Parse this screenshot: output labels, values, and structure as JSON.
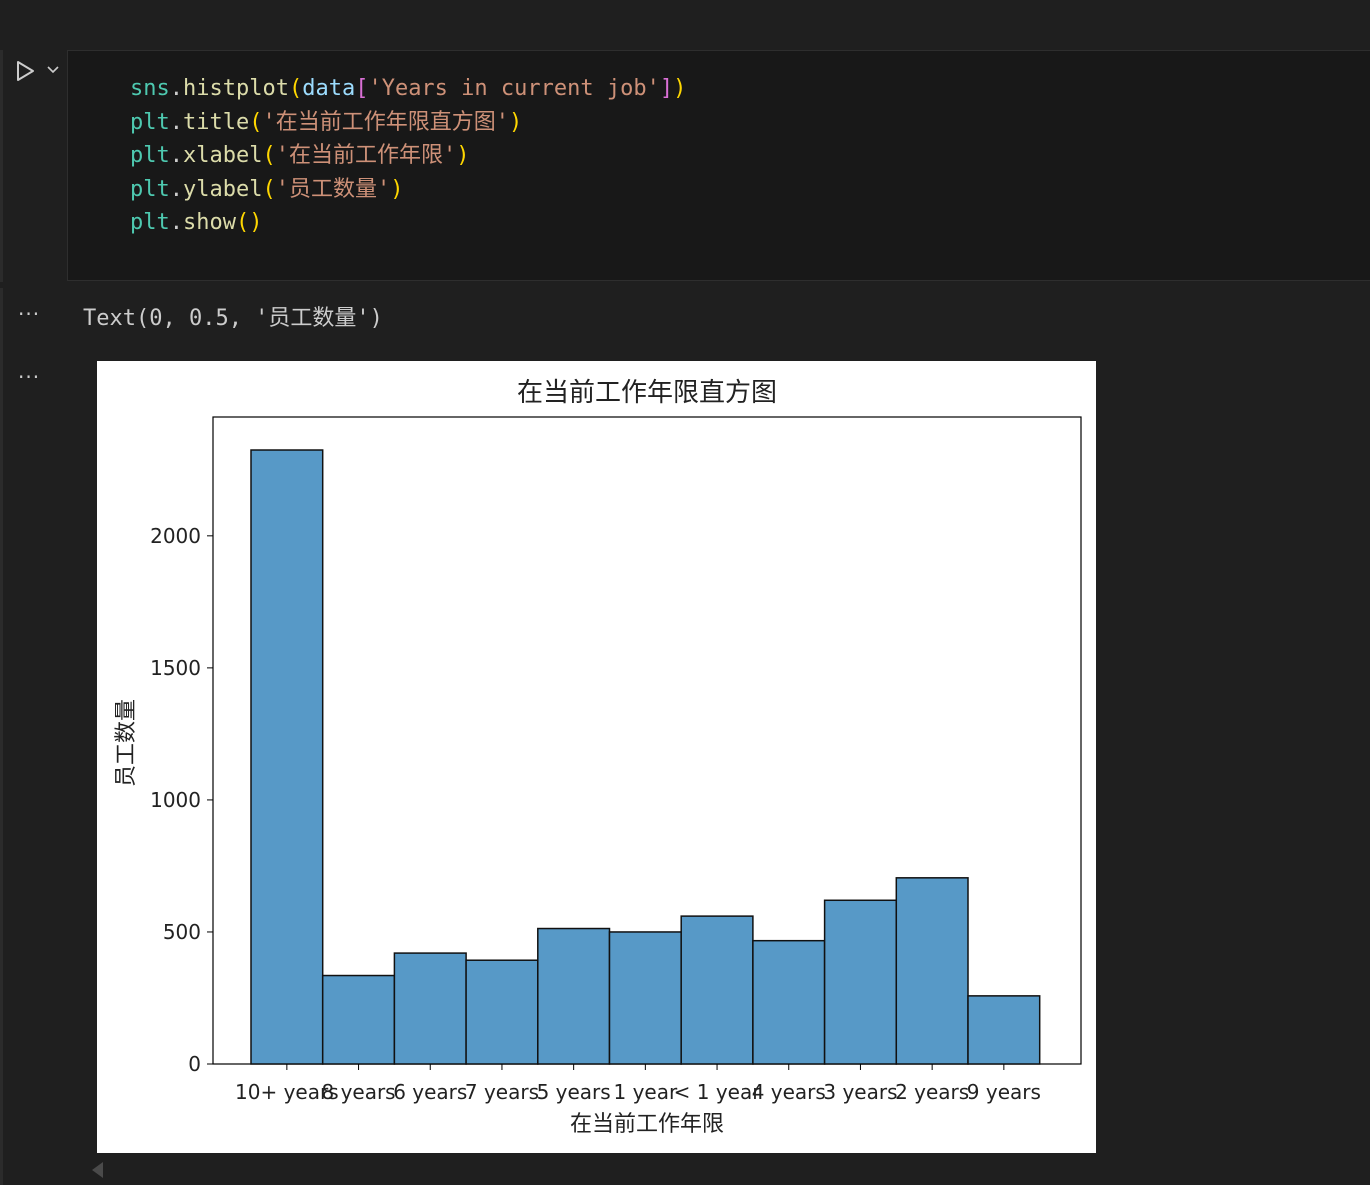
{
  "code_cell": {
    "lines": [
      [
        {
          "t": "sns",
          "c": "cyan"
        },
        {
          "t": ".",
          "c": ""
        },
        {
          "t": "histplot",
          "c": "yellow"
        },
        {
          "t": "(",
          "c": "b1"
        },
        {
          "t": "data",
          "c": "lblue"
        },
        {
          "t": "[",
          "c": "b2"
        },
        {
          "t": "'Years in current job'",
          "c": "str"
        },
        {
          "t": "]",
          "c": "b2"
        },
        {
          "t": ")",
          "c": "b1"
        }
      ],
      [
        {
          "t": "plt",
          "c": "cyan"
        },
        {
          "t": ".",
          "c": ""
        },
        {
          "t": "title",
          "c": "yellow"
        },
        {
          "t": "(",
          "c": "b1"
        },
        {
          "t": "'在当前工作年限直方图'",
          "c": "str"
        },
        {
          "t": ")",
          "c": "b1"
        }
      ],
      [
        {
          "t": "plt",
          "c": "cyan"
        },
        {
          "t": ".",
          "c": ""
        },
        {
          "t": "xlabel",
          "c": "yellow"
        },
        {
          "t": "(",
          "c": "b1"
        },
        {
          "t": "'在当前工作年限'",
          "c": "str"
        },
        {
          "t": ")",
          "c": "b1"
        }
      ],
      [
        {
          "t": "plt",
          "c": "cyan"
        },
        {
          "t": ".",
          "c": ""
        },
        {
          "t": "ylabel",
          "c": "yellow"
        },
        {
          "t": "(",
          "c": "b1"
        },
        {
          "t": "'员工数量'",
          "c": "str"
        },
        {
          "t": ")",
          "c": "b1"
        }
      ],
      [
        {
          "t": "plt",
          "c": "cyan"
        },
        {
          "t": ".",
          "c": ""
        },
        {
          "t": "show",
          "c": "yellow"
        },
        {
          "t": "(",
          "c": "b1"
        },
        {
          "t": ")",
          "c": "b1"
        }
      ]
    ]
  },
  "output": {
    "more_label": "···",
    "text_result": "Text(0, 0.5, '员工数量')"
  },
  "colors": {
    "bar_fill": "#5799c7",
    "bar_edge": "#111111"
  },
  "chart_data": {
    "type": "bar",
    "title": "在当前工作年限直方图",
    "xlabel": "在当前工作年限",
    "ylabel": "员工数量",
    "categories": [
      "10+ years",
      "8 years",
      "6 years",
      "7 years",
      "5 years",
      "1 year",
      "< 1 year",
      "4 years",
      "3 years",
      "2 years",
      "9 years"
    ],
    "values": [
      2325,
      335,
      420,
      393,
      513,
      500,
      560,
      467,
      620,
      705,
      258
    ],
    "yticks": [
      0,
      500,
      1000,
      1500,
      2000
    ],
    "ylim": [
      0,
      2450
    ],
    "grid": false,
    "legend": "none"
  }
}
